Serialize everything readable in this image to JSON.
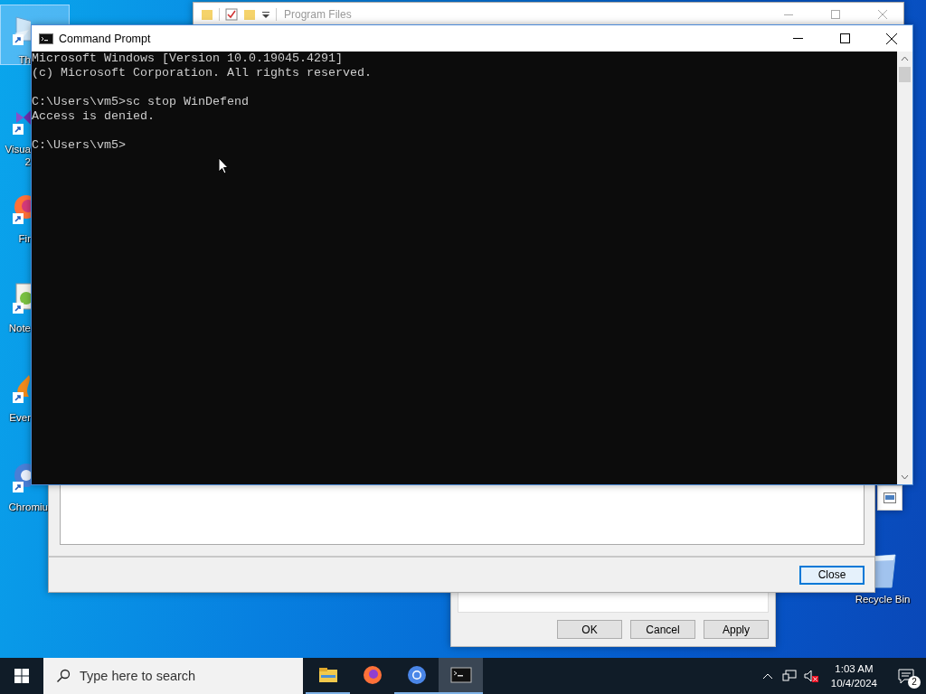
{
  "desktop_icons": [
    {
      "kind": "document",
      "label_lines": [
        "Th"
      ],
      "selected": true
    },
    {
      "kind": "visual-studio",
      "label_lines": [
        "Visua",
        "2"
      ],
      "selected": false
    },
    {
      "kind": "firefox",
      "label_lines": [
        "Fir"
      ],
      "selected": false
    },
    {
      "kind": "notepad",
      "label_lines": [
        "Note"
      ],
      "selected": false
    },
    {
      "kind": "everything",
      "label_lines": [
        "Ever"
      ],
      "selected": false
    },
    {
      "kind": "chromium",
      "label_lines": [
        "Chromiu"
      ],
      "selected": false
    }
  ],
  "recycle_bin": {
    "label": "Recycle Bin"
  },
  "explorer_window": {
    "title": "Program Files"
  },
  "properties_dialog": {
    "buttons": [
      {
        "label": "OK",
        "focused": false
      },
      {
        "label": "Cancel",
        "focused": false
      },
      {
        "label": "Apply",
        "focused": false
      }
    ]
  },
  "conditions_dialog": {
    "buttons": [
      {
        "label": "Close",
        "focused": true
      }
    ]
  },
  "command_prompt": {
    "title": "Command Prompt",
    "output_blocks": [
      [
        "Microsoft Windows [Version 10.0.19045.4291]",
        "(c) Microsoft Corporation. All rights reserved."
      ],
      [
        "C:\\Users\\vm5>sc stop WinDefend",
        "Access is denied."
      ],
      [
        "C:\\Users\\vm5>"
      ]
    ]
  },
  "taskbar": {
    "search": {
      "placeholder": "Type here to search"
    },
    "apps": [
      {
        "kind": "file-explorer",
        "running": true,
        "active": false
      },
      {
        "kind": "firefox",
        "running": false,
        "active": false
      },
      {
        "kind": "chromium",
        "running": true,
        "active": false
      },
      {
        "kind": "terminal",
        "running": true,
        "active": true
      }
    ],
    "tray": {
      "volume_muted": true
    },
    "clock": {
      "time": "1:03 AM",
      "date": "10/4/2024"
    },
    "notifications": {
      "count": "2"
    }
  }
}
